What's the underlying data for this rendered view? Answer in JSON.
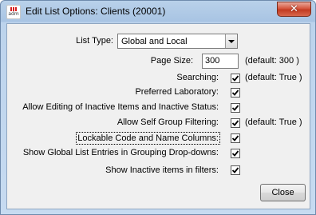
{
  "window": {
    "title": "Edit List Options: Clients (20001)",
    "icon_text": "adm",
    "close_glyph": "✕"
  },
  "form": {
    "list_type": {
      "label": "List Type:",
      "value": "Global and Local"
    },
    "page_size": {
      "label": "Page Size:",
      "value": "300",
      "default_text": "(default: 300   )"
    },
    "searching": {
      "label": "Searching:",
      "checked": true,
      "default_text": "(default: True   )"
    },
    "preferred_lab": {
      "label": "Preferred Laboratory:",
      "checked": true
    },
    "allow_inactive": {
      "label": "Allow Editing of Inactive Items and Inactive Status:",
      "checked": true
    },
    "self_group": {
      "label": "Allow Self Group Filtering:",
      "checked": true,
      "default_text": "(default: True   )"
    },
    "lockable": {
      "label": "Lockable Code and Name Columns:",
      "checked": true
    },
    "global_entries": {
      "label": "Show Global List Entries in Grouping Drop-downs:",
      "checked": true
    },
    "show_inactive": {
      "label": "Show Inactive items in filters:",
      "checked": true
    }
  },
  "buttons": {
    "close_label": "Close"
  },
  "colors": {
    "title_bg": "#b9d1ea",
    "close_red": "#c23b22",
    "client_bg": "#f0f0f0"
  }
}
